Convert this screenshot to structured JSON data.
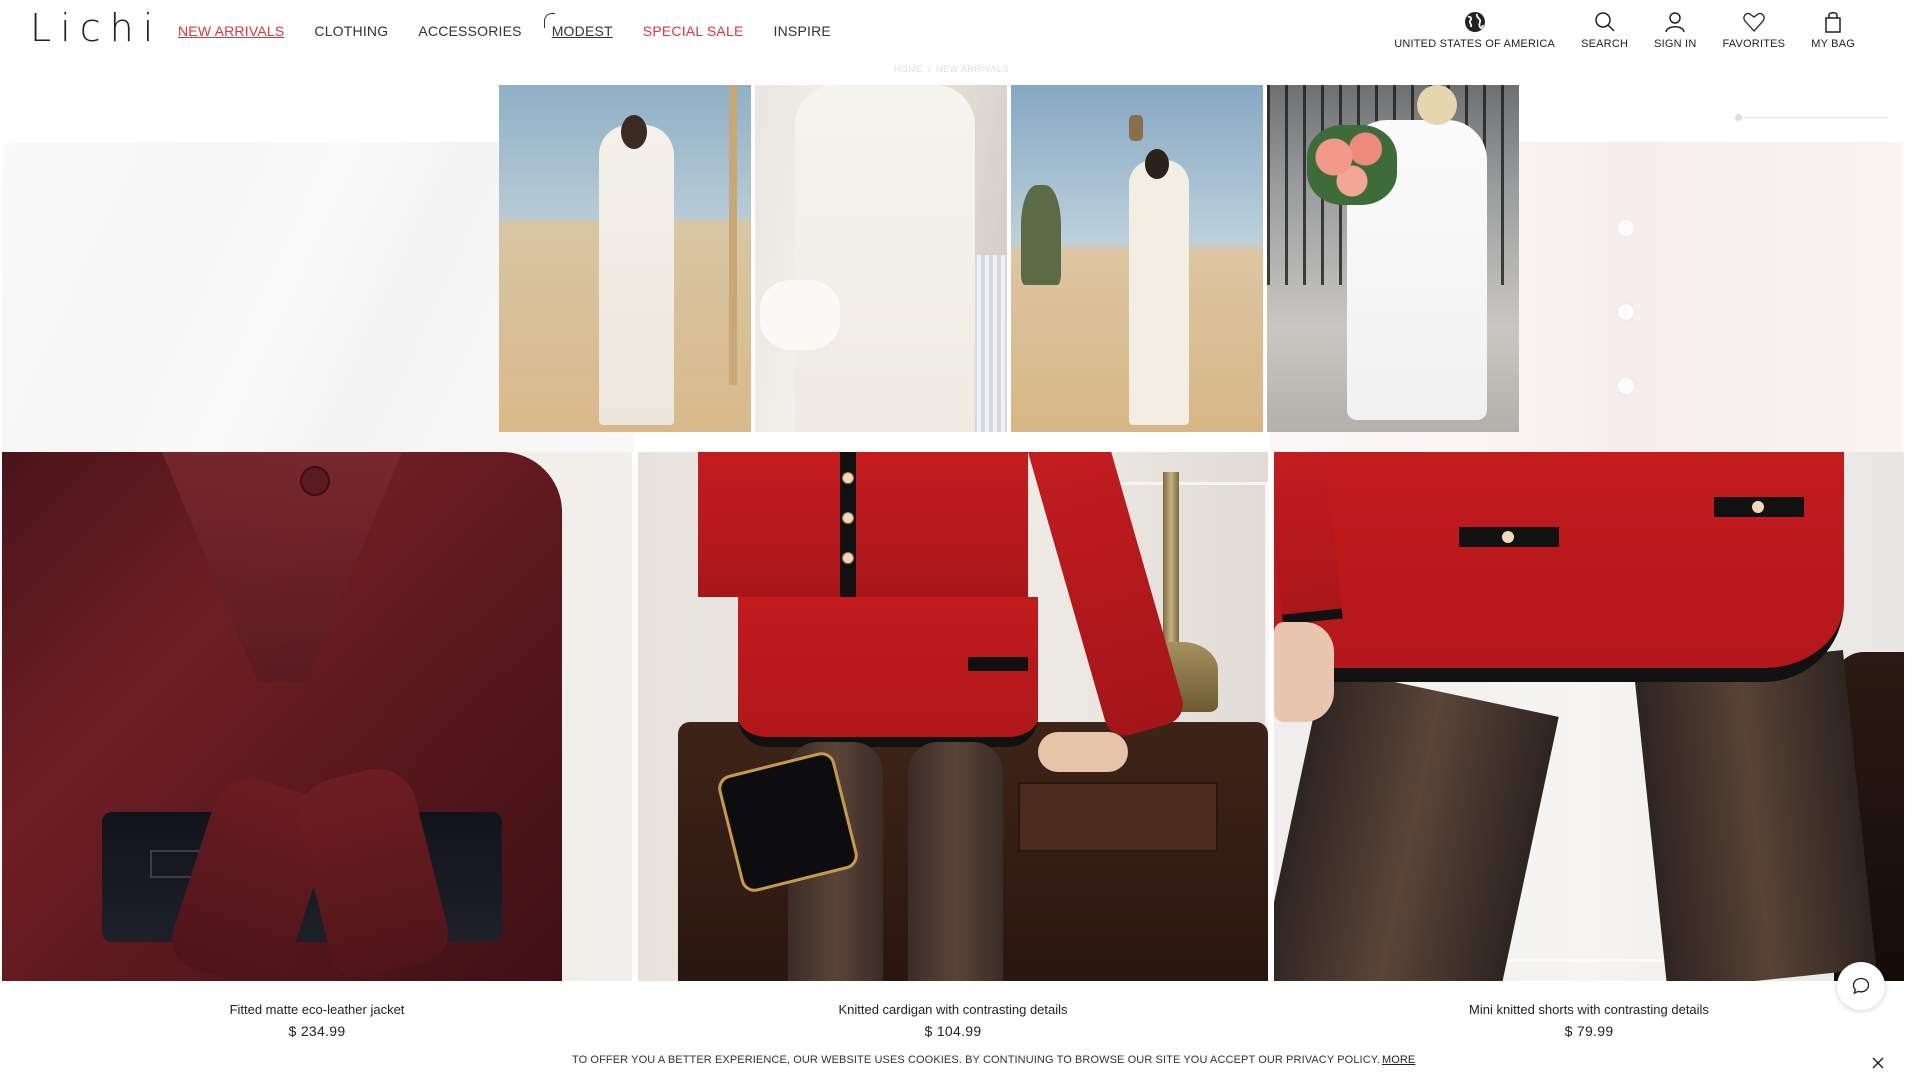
{
  "header": {
    "logo": "Lichi",
    "nav": [
      {
        "label": "NEW ARRIVALS"
      },
      {
        "label": "CLOTHING"
      },
      {
        "label": "ACCESSORIES"
      },
      {
        "label": "MODEST"
      },
      {
        "label": "SPECIAL SALE"
      },
      {
        "label": "INSPIRE"
      }
    ],
    "tools": {
      "region": "UNITED STATES OF AMERICA",
      "search": "SEARCH",
      "signin": "SIGN IN",
      "favorites": "FAVORITES",
      "bag": "MY BAG"
    },
    "icons": {
      "region": "globe-icon",
      "search": "search-icon",
      "signin": "user-icon",
      "favorites": "heart-icon",
      "bag": "bag-icon"
    }
  },
  "breadcrumb": {
    "home": "HOME",
    "separator": "/",
    "current": "NEW ARRIVALS"
  },
  "popup_gallery": {
    "images": [
      "woman in white suit on desert runway",
      "white dress with feather cuffs",
      "runway show in desert with palm trees",
      "woman in white dress holding peonies"
    ]
  },
  "products": [
    {
      "name": "Fitted matte eco-leather jacket",
      "price": "$ 234.99"
    },
    {
      "name": "Knitted cardigan with contrasting details",
      "price": "$ 104.99"
    },
    {
      "name": "Mini knitted shorts with contrasting details",
      "price": "$ 79.99"
    }
  ],
  "cookie": {
    "text": "TO OFFER YOU A BETTER EXPERIENCE, OUR WEBSITE USES COOKIES. BY CONTINUING TO BROWSE OUR SITE YOU ACCEPT OUR PRIVACY POLICY.",
    "more": "MORE"
  },
  "colors": {
    "accent_red": "#e0353b",
    "text": "#222222",
    "background": "#ffffff"
  }
}
